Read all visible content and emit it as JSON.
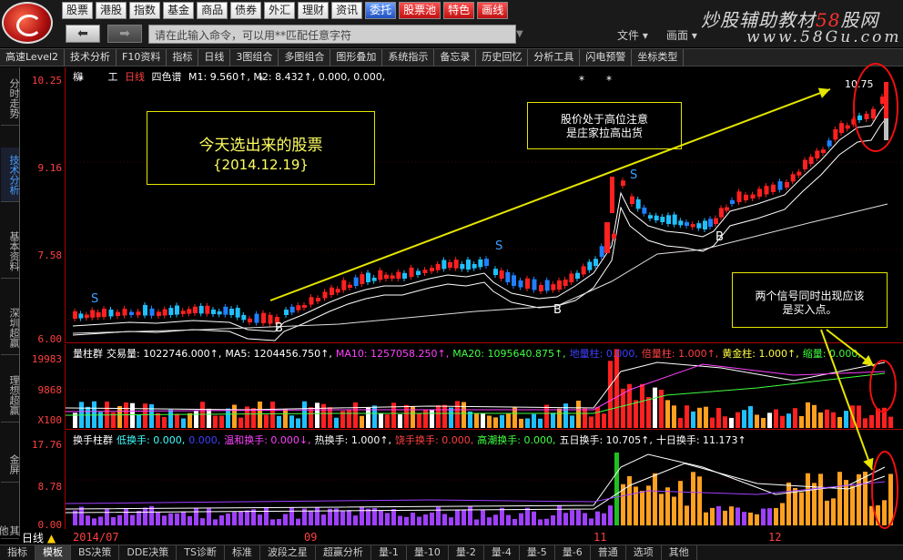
{
  "menu": {
    "items": [
      "股票",
      "港股",
      "指数",
      "基金",
      "商品",
      "债券",
      "外汇",
      "理财",
      "资讯",
      "委托",
      "股票池",
      "特色",
      "画线"
    ],
    "command_placeholder": "请在此输入命令，可以用**匹配任意字符",
    "file": "文件",
    "view": "画面",
    "brand_prefix": "炒股辅助教材",
    "brand_highlight": "58",
    "brand_suffix": "股网",
    "brand_url": "www.58Gu.com"
  },
  "toolbar": {
    "items": [
      "高速Level2",
      "技术分析",
      "F10资料",
      "指标",
      "日线",
      "3图组合",
      "多图组合",
      "图形叠加",
      "系统指示",
      "备忘录",
      "历史回忆",
      "分析工具",
      "闪电预警",
      "坐标类型"
    ]
  },
  "left_tabs": [
    "分时走势",
    "技术分析",
    "基本资料",
    "深圳超赢",
    "理想超赢",
    "金屏",
    "其他"
  ],
  "price_pane": {
    "stock_name": "柳",
    "stock_code": "工",
    "period": "日线",
    "indicator_title": "四色谱",
    "indicator_values": "M1: 9.560↑, M2: 8.432↑, 0.000, 0.000,",
    "y_labels": [
      "10.25",
      "9.16",
      "7.58",
      "6.00"
    ],
    "high_marker": "10.75",
    "signal_sell": "S",
    "signal_buy": "B"
  },
  "volume_pane": {
    "header": [
      {
        "label": "量柱群",
        "color": "#ffffff"
      },
      {
        "label": "交易量: 1022746.000↑,",
        "color": "#ffffff"
      },
      {
        "label": "MA5: 1204456.750↑,",
        "color": "#ffffff"
      },
      {
        "label": "MA10: 1257058.250↑,",
        "color": "#ff40ff"
      },
      {
        "label": "MA20: 1095640.875↑,",
        "color": "#40ff40"
      },
      {
        "label": "地量柱: 0.000,",
        "color": "#4040ff"
      },
      {
        "label": "倍量柱: 1.000↑,",
        "color": "#ff4040"
      },
      {
        "label": "黄金柱: 1.000↑,",
        "color": "#ffff40"
      },
      {
        "label": "缩量: 0.000,",
        "color": "#40ff40"
      }
    ],
    "y_labels": [
      "19983",
      "9868",
      "X100"
    ]
  },
  "turnover_pane": {
    "header": [
      {
        "label": "换手柱群",
        "color": "#ffffff"
      },
      {
        "label": "低换手: 0.000,",
        "color": "#40ffff"
      },
      {
        "label": "0.000,",
        "color": "#4040ff"
      },
      {
        "label": "温和换手: 0.000↓,",
        "color": "#ff40ff"
      },
      {
        "label": "热换手: 1.000↑,",
        "color": "#ffffff"
      },
      {
        "label": "饶手换手: 0.000,",
        "color": "#ff4040"
      },
      {
        "label": "高潮换手: 0.000,",
        "color": "#40ff40"
      },
      {
        "label": "五日换手: 10.705↑,",
        "color": "#ffffff"
      },
      {
        "label": "十日换手: 11.173↑",
        "color": "#ffffff"
      }
    ],
    "y_labels": [
      "17.76",
      "8.78",
      "0.00"
    ]
  },
  "annotations": {
    "note1_line1": "今天选出来的股票",
    "note1_line2": "{2014.12.19}",
    "note2_line1": "股价处于高位注意",
    "note2_line2": "是庄家拉高出货",
    "note3_line1": "两个信号同时出现应该",
    "note3_line2": "是买入点。"
  },
  "date_axis": [
    "2014/07",
    "09",
    "11",
    "12"
  ],
  "bottom_tabs": [
    "指标",
    "模板",
    "BS决策",
    "DDE决策",
    "TS诊断",
    "标准",
    "波段之星",
    "超赢分析",
    "量-1",
    "量-10",
    "量-2",
    "量-4",
    "量-5",
    "量-6",
    "普通",
    "选项",
    "其他"
  ],
  "period_label": "日线",
  "colors": {
    "up": "#ff2020",
    "down": "#2080ff",
    "annotation": "#ffff60",
    "axis": "#aa0000"
  }
}
